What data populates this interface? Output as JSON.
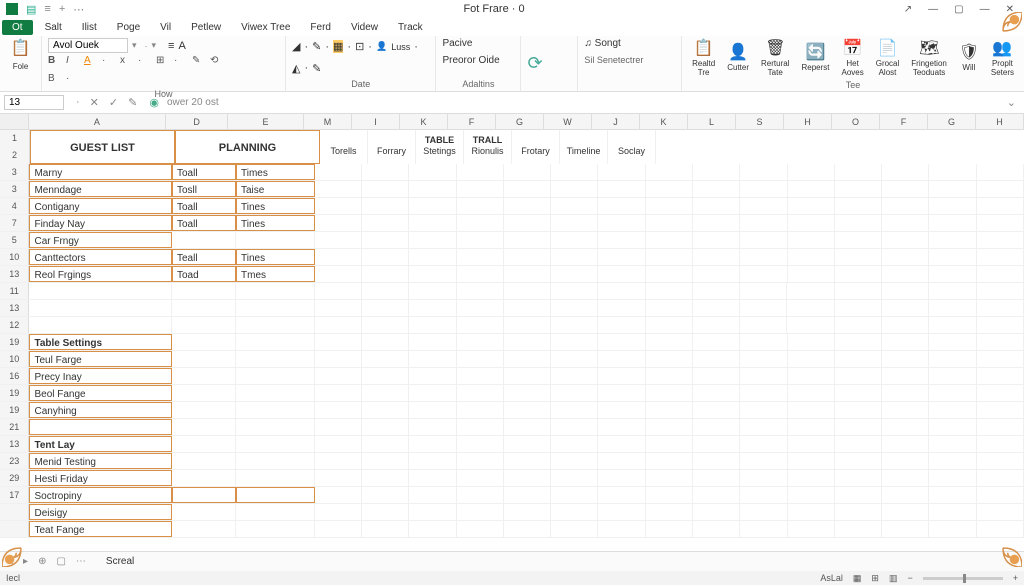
{
  "title_bar": {
    "title": "Fot Frare ·  0"
  },
  "tabs": [
    "Salt",
    "Ilist",
    "Poge",
    "Vil",
    "Petlew",
    "Viwex Tree",
    "Ferd",
    "Videw",
    "Track"
  ],
  "file_tab": "Ot",
  "font_name": "Avol Ouek",
  "ribbon": {
    "group_font": "How",
    "group_date": "Date",
    "group_addins": "Adaltins",
    "group_tee": "Tee",
    "pacive": "Pacive",
    "preoror": "Preoror Oide",
    "loss": "Luss",
    "songt": "Songt",
    "senet": "Sil Senetectrer",
    "btns": [
      {
        "label": "Realtd\nTre",
        "icon": "clipboard"
      },
      {
        "label": "Cutter",
        "icon": "cutter"
      },
      {
        "label": "Rertural\nTate",
        "icon": "trash"
      },
      {
        "label": "Reperst",
        "icon": "refresh"
      },
      {
        "label": "Het\nAoves",
        "icon": "calendar"
      },
      {
        "label": "Grocal\nAlost",
        "icon": "note"
      },
      {
        "label": "Fringetion\nTeoduats",
        "icon": "map"
      },
      {
        "label": "Will",
        "icon": "shield"
      },
      {
        "label": "Proplt\nSeters",
        "icon": "people"
      }
    ]
  },
  "formula_bar": {
    "name_box": "13",
    "formula": "ower 20 ost"
  },
  "col_headers": [
    "A",
    "D",
    "E",
    "M",
    "I",
    "K",
    "F",
    "G",
    "W",
    "J",
    "K",
    "L",
    "S",
    "H",
    "O",
    "F",
    "G",
    "H"
  ],
  "nav_cells": [
    {
      "l1": "",
      "l2": "Torells"
    },
    {
      "l1": "",
      "l2": "Forrary"
    },
    {
      "l1": "TABLE",
      "l2": "Stetings"
    },
    {
      "l1": "TRALL",
      "l2": "Rionulis"
    },
    {
      "l1": "",
      "l2": "Frotary"
    },
    {
      "l1": "",
      "l2": "Timeline"
    },
    {
      "l1": "",
      "l2": "Soclay"
    }
  ],
  "section_guest": "GUEST LIST",
  "section_planning": "PLANNING",
  "rows": [
    {
      "n": "3",
      "a": "Marny",
      "d": "Toall",
      "e": "Times",
      "ob": true
    },
    {
      "n": "3",
      "a": "Menndage",
      "d": "Tosll",
      "e": "Taise",
      "ob": true
    },
    {
      "n": "4",
      "a": "Contigany",
      "d": "Toall",
      "e": "Tines",
      "ob": true
    },
    {
      "n": "7",
      "a": "Finday Nay",
      "d": "Toall",
      "e": "Tines",
      "ob": true
    },
    {
      "n": "5",
      "a": "Car Frngy",
      "d": "",
      "e": "",
      "ob": true,
      "de_empty": true
    },
    {
      "n": "10",
      "a": "Canttectors",
      "d": "Teall",
      "e": "Tines",
      "ob": true
    },
    {
      "n": "13",
      "a": "Reol Frgings",
      "d": "Toad",
      "e": "Tmes",
      "ob": true
    },
    {
      "n": "11",
      "a": "",
      "d": "",
      "e": ""
    },
    {
      "n": "13",
      "a": "",
      "d": "",
      "e": ""
    },
    {
      "n": "12",
      "a": "",
      "d": "",
      "e": ""
    },
    {
      "n": "19",
      "a": "Table Settings",
      "d": "",
      "e": "",
      "bold": true,
      "ob": true,
      "de_empty": true
    },
    {
      "n": "10",
      "a": "Teul Farge",
      "d": "",
      "e": "",
      "ob": true,
      "de_empty": true
    },
    {
      "n": "16",
      "a": "Precy Inay",
      "d": "",
      "e": "",
      "ob": true,
      "de_empty": true
    },
    {
      "n": "19",
      "a": "Beol Fange",
      "d": "",
      "e": "",
      "ob": true,
      "de_empty": true
    },
    {
      "n": "19",
      "a": "Canyhing",
      "d": "",
      "e": "",
      "ob": true,
      "de_empty": true
    },
    {
      "n": "21",
      "a": "",
      "d": "",
      "e": "",
      "ob": true,
      "de_empty": true
    },
    {
      "n": "13",
      "a": "Tent Lay",
      "d": "",
      "e": "",
      "bold": true,
      "ob": true,
      "de_empty": true
    },
    {
      "n": "23",
      "a": "Menid Testing",
      "d": "",
      "e": "",
      "ob": true,
      "de_empty": true
    },
    {
      "n": "29",
      "a": "Hesti Friday",
      "d": "",
      "e": "",
      "ob": true,
      "de_empty": true
    },
    {
      "n": "17",
      "a": "Soctropiny",
      "d": "",
      "e": "",
      "ob": true,
      "de_box": true
    },
    {
      "n": "",
      "a": "Deisigy",
      "d": "",
      "e": "",
      "ob": true,
      "de_empty": true
    },
    {
      "n": "",
      "a": "Teat Fange",
      "d": "",
      "e": "",
      "ob": true,
      "de_empty": true
    }
  ],
  "sheet_tab": "Screal",
  "status": {
    "left": "Iecl",
    "ascal": "AsLal"
  }
}
